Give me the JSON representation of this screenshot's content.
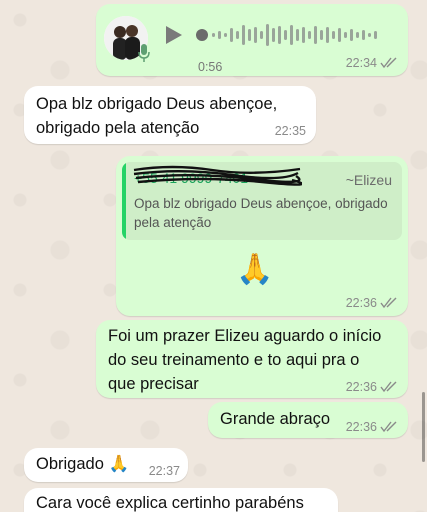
{
  "messages": {
    "voice": {
      "duration": "0:56",
      "time": "22:34"
    },
    "m1": {
      "line1": "Opa blz obrigado Deus abençoe,",
      "line2": "obrigado pela atenção",
      "time": "22:35"
    },
    "reply": {
      "quoted_phone": "+55 41 9999-7401",
      "quoted_name": "~Elizeu",
      "quoted_line1": "Opa blz obrigado Deus abençoe, obrigado",
      "quoted_line2": "pela atenção",
      "emoji": "🙏",
      "time": "22:36"
    },
    "m3": {
      "line1": "Foi um prazer Elizeu aguardo o início",
      "line2": "do seu treinamento e to aqui pra o",
      "line3": "que precisar",
      "time": "22:36"
    },
    "m4": {
      "text": "Grande abraço",
      "time": "22:36"
    },
    "m5": {
      "text": "Obrigado 🙏",
      "time": "22:37"
    },
    "m6": {
      "text": "Cara você explica certinho parabéns"
    }
  },
  "colors": {
    "outgoing": "#d9fdd3",
    "incoming": "#ffffff",
    "tick": "#8a8a8a",
    "accent": "#25d366"
  }
}
